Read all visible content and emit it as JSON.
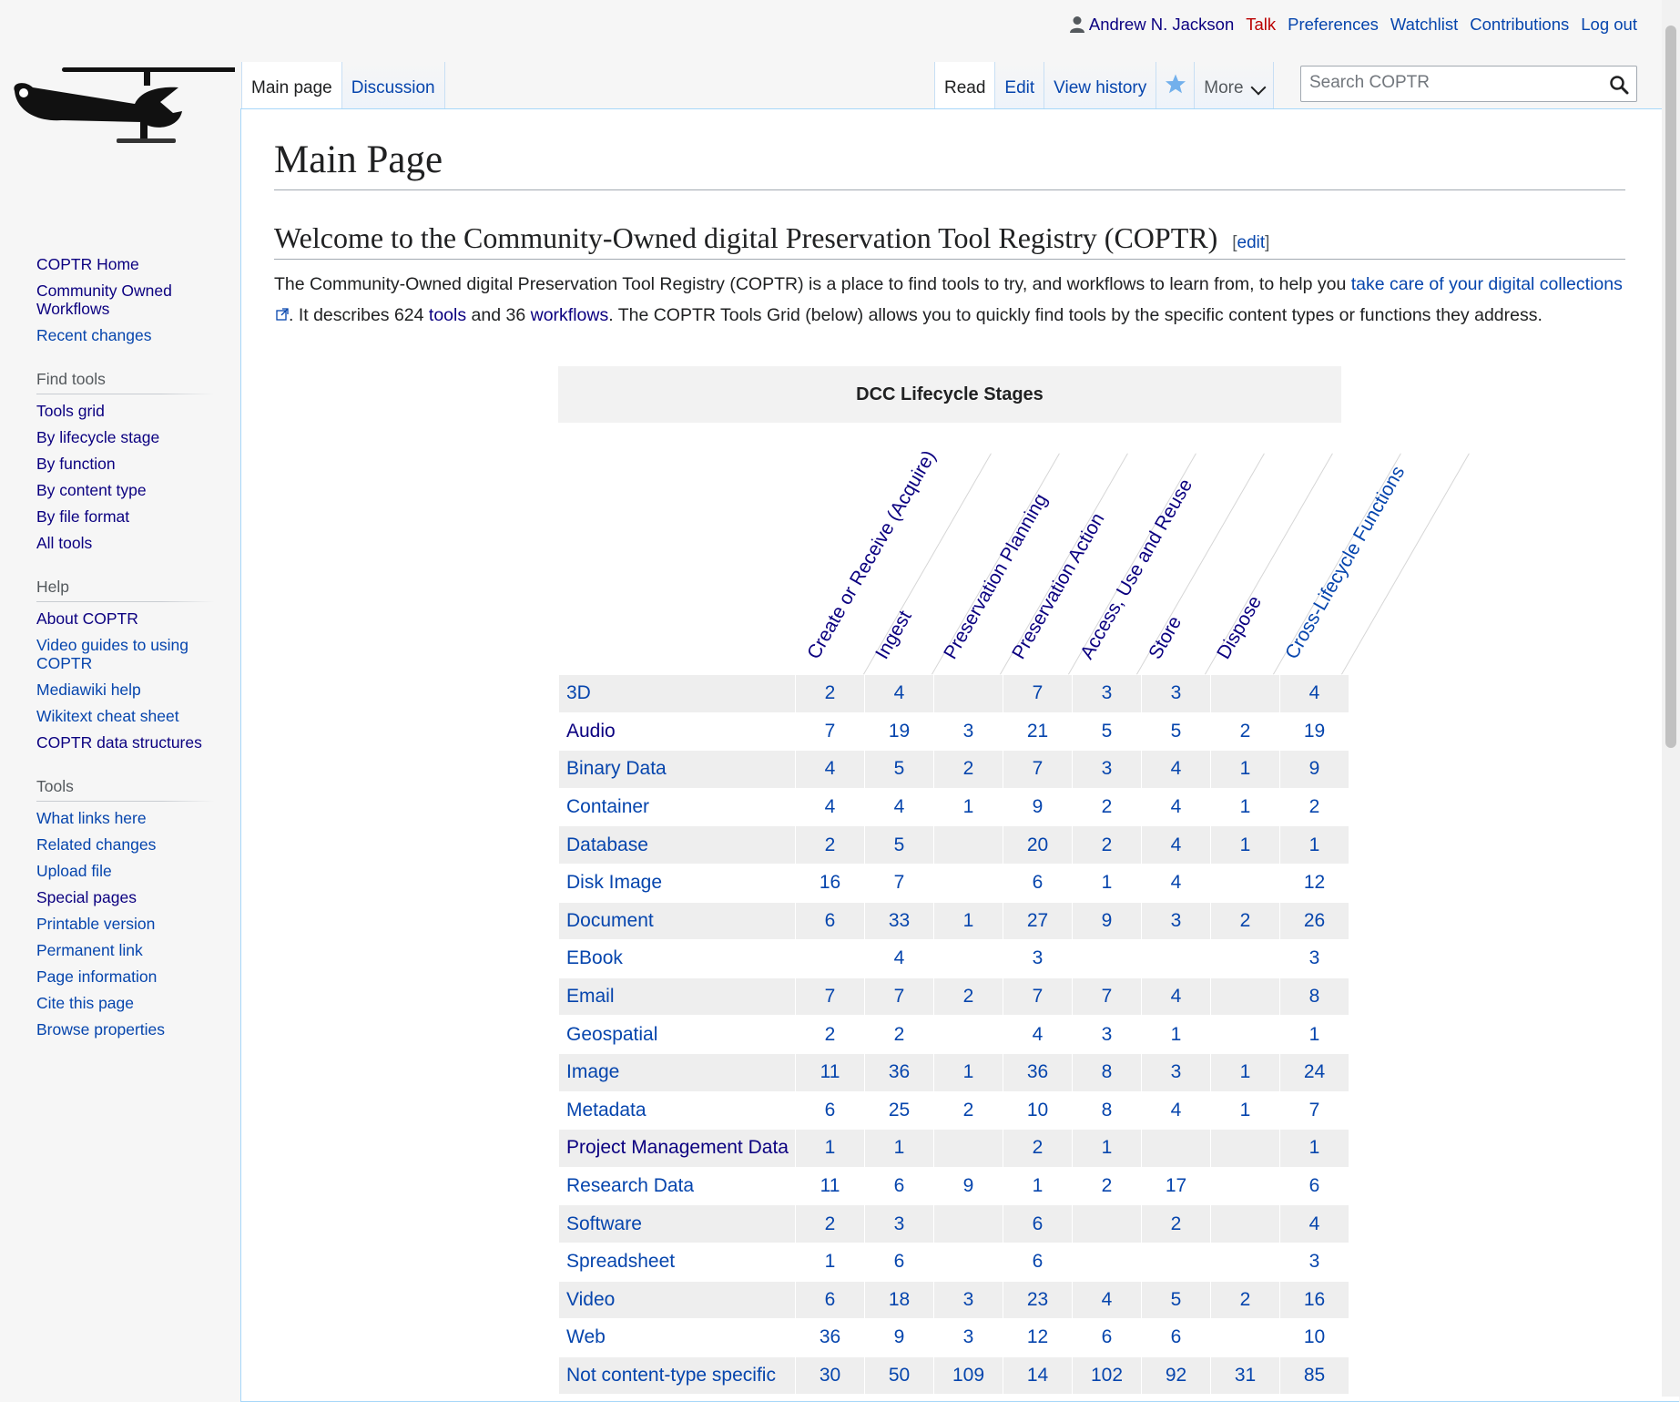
{
  "personal": {
    "user": "Andrew N. Jackson",
    "talk": "Talk",
    "preferences": "Preferences",
    "watchlist": "Watchlist",
    "contributions": "Contributions",
    "logout": "Log out"
  },
  "tabs": {
    "main_page": "Main page",
    "discussion": "Discussion",
    "read": "Read",
    "edit": "Edit",
    "view_history": "View history",
    "more": "More"
  },
  "search": {
    "placeholder": "Search COPTR"
  },
  "sidebar": {
    "nav": [
      "COPTR Home",
      "Community Owned Workflows",
      "Recent changes"
    ],
    "find_tools": {
      "title": "Find tools",
      "items": [
        "Tools grid",
        "By lifecycle stage",
        "By function",
        "By content type",
        "By file format",
        "All tools"
      ]
    },
    "help": {
      "title": "Help",
      "items": [
        "About COPTR",
        "Video guides to using COPTR",
        "Mediawiki help",
        "Wikitext cheat sheet",
        "COPTR data structures"
      ]
    },
    "tools": {
      "title": "Tools",
      "items": [
        "What links here",
        "Related changes",
        "Upload file",
        "Special pages",
        "Printable version",
        "Permanent link",
        "Page information",
        "Cite this page",
        "Browse properties"
      ]
    }
  },
  "page": {
    "title": "Main Page",
    "section_title": "Welcome to the Community-Owned digital Preservation Tool Registry (COPTR)",
    "edit_open": "[",
    "edit_label": "edit",
    "edit_close": "]",
    "intro_1": "The Community-Owned digital Preservation Tool Registry (COPTR) is a place to find tools to try, and workflows to learn from, to help you ",
    "intro_link_1": "take care of your digital collections",
    "intro_2": ". It describes 624 ",
    "intro_link_tools": "tools",
    "intro_3": " and 36 ",
    "intro_link_workflows": "workflows",
    "intro_4": ". The COPTR Tools Grid (below) allows you to quickly find tools by the specific content types or functions they address."
  },
  "grid": {
    "caption": "DCC Lifecycle Stages",
    "columns": [
      "Create or Receive (Acquire)",
      "Ingest",
      "Preservation Planning",
      "Preservation Action",
      "Access, Use and Reuse",
      "Store",
      "Dispose",
      "Cross-Lifecycle Functions"
    ],
    "rows": [
      {
        "label": "3D",
        "values": [
          "2",
          "4",
          "",
          "7",
          "3",
          "3",
          "",
          "4"
        ]
      },
      {
        "label": "Audio",
        "values": [
          "7",
          "19",
          "3",
          "21",
          "5",
          "5",
          "2",
          "19"
        ]
      },
      {
        "label": "Binary Data",
        "values": [
          "4",
          "5",
          "2",
          "7",
          "3",
          "4",
          "1",
          "9"
        ]
      },
      {
        "label": "Container",
        "values": [
          "4",
          "4",
          "1",
          "9",
          "2",
          "4",
          "1",
          "2"
        ]
      },
      {
        "label": "Database",
        "values": [
          "2",
          "5",
          "",
          "20",
          "2",
          "4",
          "1",
          "1"
        ]
      },
      {
        "label": "Disk Image",
        "values": [
          "16",
          "7",
          "",
          "6",
          "1",
          "4",
          "",
          "12"
        ]
      },
      {
        "label": "Document",
        "values": [
          "6",
          "33",
          "1",
          "27",
          "9",
          "3",
          "2",
          "26"
        ]
      },
      {
        "label": "EBook",
        "values": [
          "",
          "4",
          "",
          "3",
          "",
          "",
          "",
          "3"
        ]
      },
      {
        "label": "Email",
        "values": [
          "7",
          "7",
          "2",
          "7",
          "7",
          "4",
          "",
          "8"
        ]
      },
      {
        "label": "Geospatial",
        "values": [
          "2",
          "2",
          "",
          "4",
          "3",
          "1",
          "",
          "1"
        ]
      },
      {
        "label": "Image",
        "values": [
          "11",
          "36",
          "1",
          "36",
          "8",
          "3",
          "1",
          "24"
        ]
      },
      {
        "label": "Metadata",
        "values": [
          "6",
          "25",
          "2",
          "10",
          "8",
          "4",
          "1",
          "7"
        ]
      },
      {
        "label": "Project Management Data",
        "values": [
          "1",
          "1",
          "",
          "2",
          "1",
          "",
          "",
          "1"
        ]
      },
      {
        "label": "Research Data",
        "values": [
          "11",
          "6",
          "9",
          "1",
          "2",
          "17",
          "",
          "6"
        ]
      },
      {
        "label": "Software",
        "values": [
          "2",
          "3",
          "",
          "6",
          "",
          "2",
          "",
          "4"
        ]
      },
      {
        "label": "Spreadsheet",
        "values": [
          "1",
          "6",
          "",
          "6",
          "",
          "",
          "",
          "3"
        ]
      },
      {
        "label": "Video",
        "values": [
          "6",
          "18",
          "3",
          "23",
          "4",
          "5",
          "2",
          "16"
        ]
      },
      {
        "label": "Web",
        "values": [
          "36",
          "9",
          "3",
          "12",
          "6",
          "6",
          "",
          "10"
        ]
      },
      {
        "label": "Not content-type specific",
        "values": [
          "30",
          "50",
          "109",
          "14",
          "102",
          "92",
          "31",
          "85"
        ]
      }
    ]
  }
}
